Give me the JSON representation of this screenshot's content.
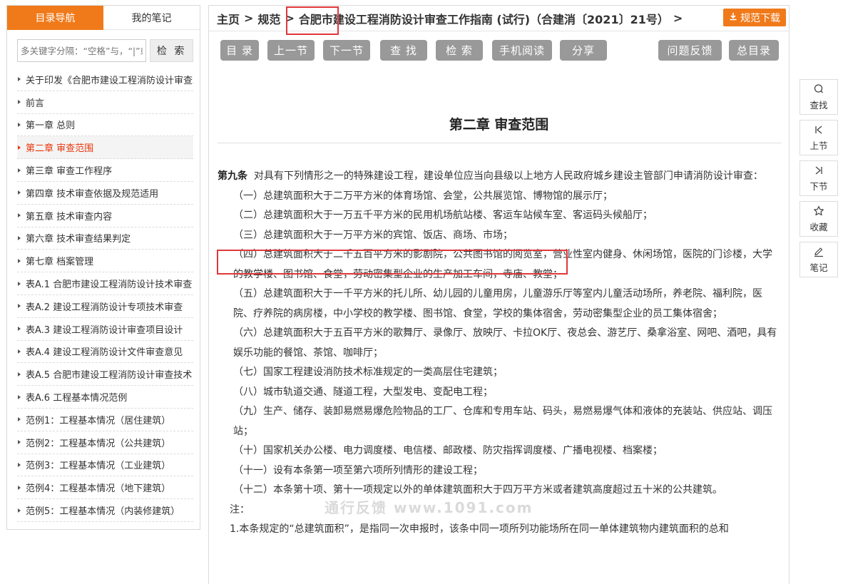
{
  "left_panel": {
    "tab_toc": "目录导航",
    "tab_notes": "我的笔记",
    "search_placeholder": "多关键字分隔：“空格”与，“|”或",
    "search_button": "检 索",
    "toc": [
      "关于印发《合肥市建设工程消防设计审查工作指南（试行）》的通知",
      "前言",
      "第一章 总则",
      "第二章 审查范围",
      "第三章 审查工作程序",
      "第四章 技术审查依据及规范适用",
      "第五章 技术审查内容",
      "第六章 技术审查结果判定",
      "第七章 档案管理",
      "表A.1 合肥市建设工程消防设计技术审查",
      "表A.2 建设工程消防设计专项技术审查",
      "表A.3 建设工程消防设计审查项目设计",
      "表A.4 建设工程消防设计文件审查意见",
      "表A.5 合肥市建设工程消防设计审查技术",
      "表A.6 工程基本情况范例",
      "范例1：工程基本情况（居住建筑）",
      "范例2：工程基本情况（公共建筑）",
      "范例3：工程基本情况（工业建筑）",
      "范例4：工程基本情况（地下建筑）",
      "范例5：工程基本情况（内装修建筑）"
    ],
    "active_index": 3
  },
  "breadcrumb": {
    "home": "主页",
    "category": "规范",
    "current": "合肥市建设工程消防设计审查工作指南 (试行)（合建消〔2021〕21号）",
    "sep": ">",
    "download": "规范下载"
  },
  "toolbar": {
    "buttons": [
      "目 录",
      "上一节",
      "下一节",
      "查 找",
      "检 索",
      "手机阅读",
      "分享"
    ],
    "feedback": "问题反馈",
    "all_toc": "总目录"
  },
  "article": {
    "chapter_title": "第二章 审查范围",
    "article_label": "第九条",
    "intro": "对具有下列情形之一的特殊建设工程，建设单位应当向县级以上地方人民政府城乡建设主管部门申请消防设计审查：",
    "items": [
      "（一）总建筑面积大于二万平方米的体育场馆、会堂，公共展览馆、博物馆的展示厅；",
      "（二）总建筑面积大于一万五千平方米的民用机场航站楼、客运车站候车室、客运码头候船厅；",
      "（三）总建筑面积大于一万平方米的宾馆、饭店、商场、市场；",
      "（四）总建筑面积大于二千五百平方米的影剧院，公共图书馆的阅览室，营业性室内健身、休闲场馆，医院的门诊楼，大学的教学楼、图书馆、食堂，劳动密集型企业的生产加工车间，寺庙、教堂；",
      "（五）总建筑面积大于一千平方米的托儿所、幼儿园的儿童用房，儿童游乐厅等室内儿童活动场所，养老院、福利院，医院、疗养院的病房楼，中小学校的教学楼、图书馆、食堂，学校的集体宿舍，劳动密集型企业的员工集体宿舍；",
      "（六）总建筑面积大于五百平方米的歌舞厅、录像厅、放映厅、卡拉OK厅、夜总会、游艺厅、桑拿浴室、网吧、酒吧，具有娱乐功能的餐馆、茶馆、咖啡厅；",
      "（七）国家工程建设消防技术标准规定的一类高层住宅建筑；",
      "（八）城市轨道交通、隧道工程，大型发电、变配电工程；",
      "（九）生产、储存、装卸易燃易爆危险物品的工厂、仓库和专用车站、码头，易燃易爆气体和液体的充装站、供应站、调压站；",
      "（十）国家机关办公楼、电力调度楼、电信楼、邮政楼、防灾指挥调度楼、广播电视楼、档案楼；",
      "（十一）设有本条第一项至第六项所列情形的建设工程；",
      "（十二）本条第十项、第十一项规定以外的单体建筑面积大于四万平方米或者建筑高度超过五十米的公共建筑。"
    ],
    "note_label": "注：",
    "note_1": "1.本条规定的“总建筑面积”，是指同一次申报时，该条中同一项所列功能场所在同一单体建筑物内建筑面积的总和"
  },
  "watermark": "通行反馈 www.1091.com",
  "side_toolbar": [
    "查找",
    "上节",
    "下节",
    "收藏",
    "笔记"
  ]
}
